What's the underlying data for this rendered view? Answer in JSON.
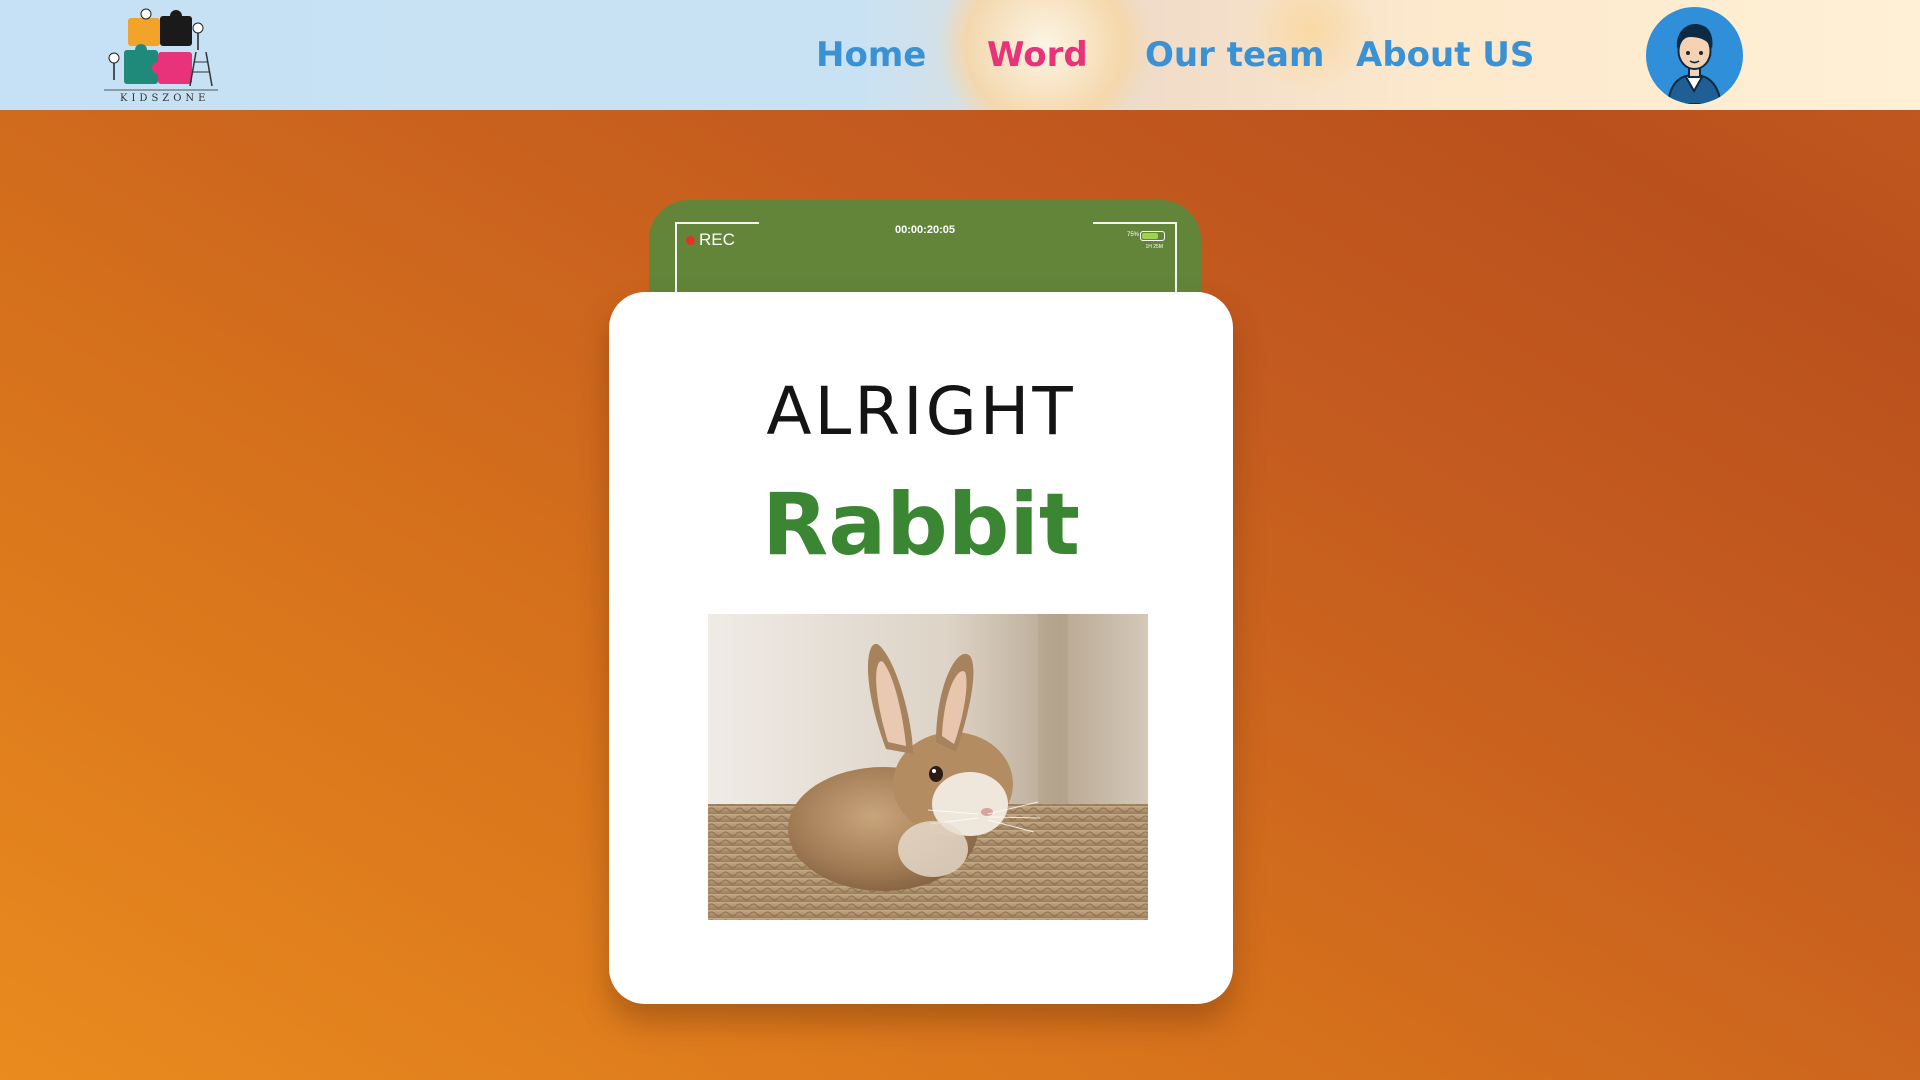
{
  "header": {
    "logo_text": "KIDSZONE",
    "nav": [
      {
        "label": "Home",
        "active": false
      },
      {
        "label": "Word",
        "active": true
      },
      {
        "label": "Our team",
        "active": false
      },
      {
        "label": "About US",
        "active": false
      }
    ]
  },
  "camera": {
    "rec_label": "REC",
    "timecode": "00:00:20:05",
    "battery_percent": "75%",
    "battery_time": "1H 25M"
  },
  "card": {
    "prefix": "ALRIGHT",
    "word": "Rabbit"
  },
  "colors": {
    "nav_default": "#3a92d4",
    "nav_active": "#e8327a",
    "word": "#3b8633",
    "camera_bar": "#62853a"
  }
}
